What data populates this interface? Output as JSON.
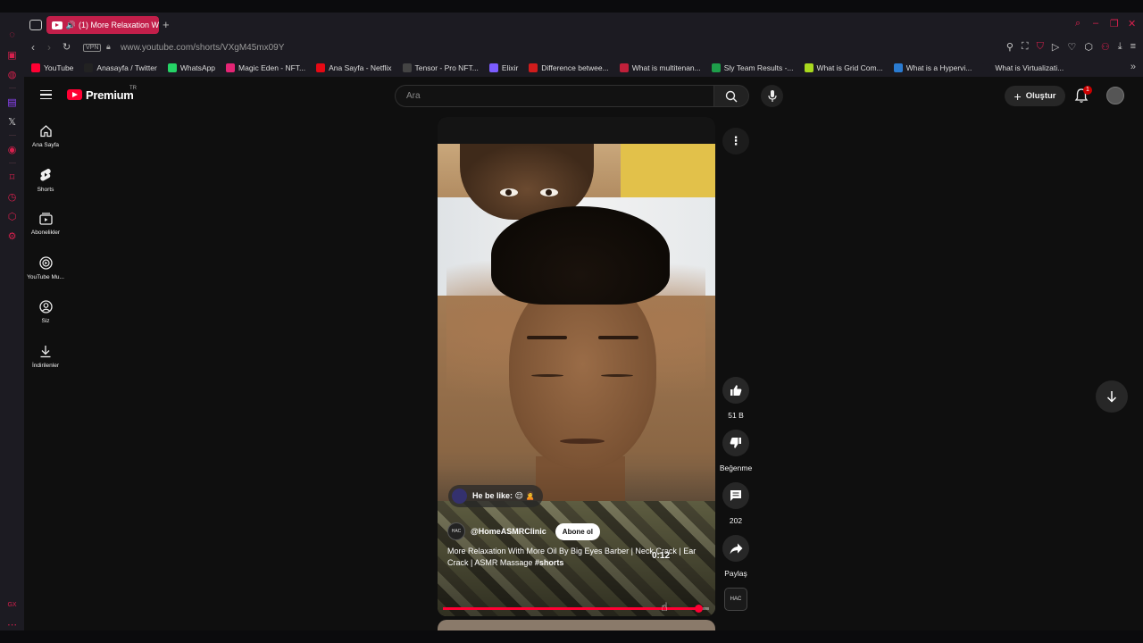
{
  "browser": {
    "tab_title": "(1) More Relaxation W",
    "url": "www.youtube.com/shorts/VXgM45mx09Y",
    "vpn_label": "VPN",
    "bookmarks": [
      {
        "label": "YouTube",
        "color": "#ff0033"
      },
      {
        "label": "Anasayfa / Twitter",
        "color": "#222222"
      },
      {
        "label": "WhatsApp",
        "color": "#25d366"
      },
      {
        "label": "Magic Eden - NFT...",
        "color": "#e42575"
      },
      {
        "label": "Ana Sayfa - Netflix",
        "color": "#e50914"
      },
      {
        "label": "Tensor - Pro NFT...",
        "color": "#444444"
      },
      {
        "label": "Elixir",
        "color": "#7b5cff"
      },
      {
        "label": "Difference betwee...",
        "color": "#d01c1c"
      },
      {
        "label": "What is multitenan...",
        "color": "#c0203a"
      },
      {
        "label": "Sly Team Results -...",
        "color": "#1e9e4a"
      },
      {
        "label": "What is Grid Com...",
        "color": "#a8d81e"
      },
      {
        "label": "What is a Hypervi...",
        "color": "#2a7bd1"
      },
      {
        "label": "What is Virtualizati...",
        "color": "#1c1b22"
      }
    ]
  },
  "youtube": {
    "brand": "Premium",
    "country": "TR",
    "search_placeholder": "Ara",
    "create_label": "Oluştur",
    "notification_count": "1",
    "guide": [
      {
        "label": "Ana Sayfa",
        "icon": "home-icon"
      },
      {
        "label": "Shorts",
        "icon": "shorts-icon"
      },
      {
        "label": "Abonelikler",
        "icon": "subscriptions-icon"
      },
      {
        "label": "YouTube Mu...",
        "icon": "youtube-music-icon"
      },
      {
        "label": "Siz",
        "icon": "you-icon"
      },
      {
        "label": "İndirilenler",
        "icon": "downloads-icon"
      }
    ]
  },
  "short": {
    "caption": "He be like: 😌 🙎",
    "channel": "@HomeASMRClinic",
    "channel_avatar_text": "HAC",
    "subscribe_label": "Abone ol",
    "title": "More Relaxation With More Oil By Big Eyes Barber | Neck Crack | Ear Crack | ASMR Massage ",
    "hashtag": "#shorts",
    "time_tooltip": "0:12",
    "progress_fraction": 0.96,
    "likes_label": "51 B",
    "dislike_label": "Beğenme",
    "comments_label": "202",
    "share_label": "Paylaş"
  },
  "colors": {
    "accent": "#ff0033",
    "opera_red": "#d6204d"
  }
}
